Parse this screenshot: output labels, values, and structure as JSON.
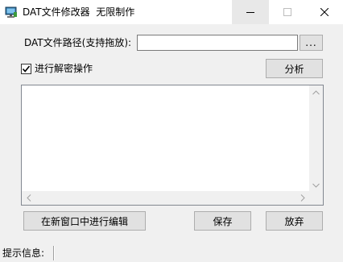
{
  "window": {
    "title": "DAT文件修改器  无限制作",
    "controls": {
      "minimize": "—",
      "maximize": "☐",
      "close": "✕"
    }
  },
  "path_row": {
    "label": "DAT文件路径(支持拖放):",
    "value": "",
    "browse_label": "..."
  },
  "decrypt": {
    "checked": true,
    "label": "进行解密操作",
    "check_mark": "✓"
  },
  "analyze_label": "分析",
  "content_area": {
    "text": ""
  },
  "buttons": {
    "edit_new_window": "在新窗口中进行编辑",
    "save": "保存",
    "discard": "放弃"
  },
  "status": {
    "label": "提示信息:"
  },
  "colors": {
    "window_bg": "#f0f0f0",
    "button_bg": "#e1e1e1",
    "border": "#adadad"
  }
}
